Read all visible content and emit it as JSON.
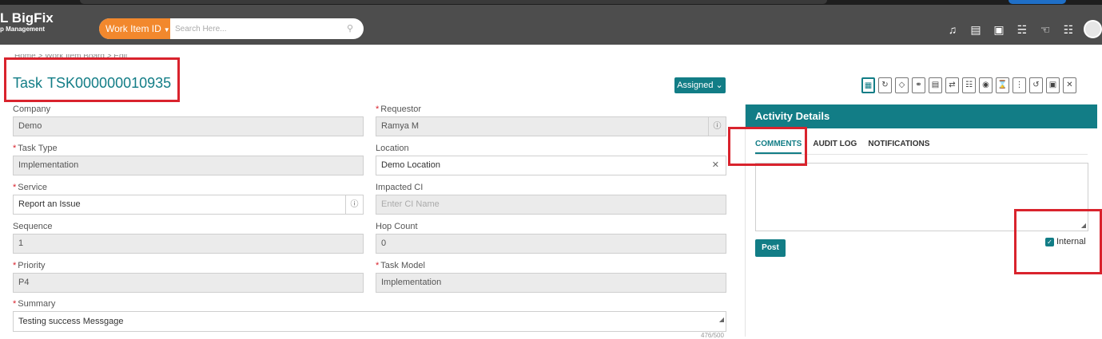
{
  "header": {
    "brand_line1": "L BigFix",
    "brand_line2": "p Management",
    "work_item_label": "Work Item ID",
    "search_placeholder": "Search Here...",
    "icons": [
      "bell-icon",
      "document-icon",
      "message-plus-icon",
      "gift-icon",
      "thumbs-up-icon",
      "cart-icon"
    ]
  },
  "breadcrumb": "Home  >  Work Item Board  >  Edit",
  "task": {
    "type_label": "Task",
    "id": "TSK000000010935",
    "status": "Assigned"
  },
  "fields": {
    "company": {
      "label": "Company",
      "value": "Demo"
    },
    "requestor": {
      "label": "Requestor",
      "value": "Ramya M"
    },
    "task_type": {
      "label": "Task Type",
      "value": "Implementation"
    },
    "location": {
      "label": "Location",
      "value": "Demo Location"
    },
    "service": {
      "label": "Service",
      "value": "Report an Issue"
    },
    "impacted_ci": {
      "label": "Impacted CI",
      "placeholder": "Enter CI Name"
    },
    "sequence": {
      "label": "Sequence",
      "value": "1"
    },
    "hop_count": {
      "label": "Hop Count",
      "value": "0"
    },
    "priority": {
      "label": "Priority",
      "value": "P4"
    },
    "task_model": {
      "label": "Task Model",
      "value": "Implementation"
    },
    "summary": {
      "label": "Summary",
      "value": "Testing success Messgage",
      "counter": "476/500"
    }
  },
  "activity": {
    "title": "Activity Details",
    "tabs": [
      "COMMENTS",
      "AUDIT LOG",
      "NOTIFICATIONS"
    ],
    "post_label": "Post",
    "internal_label": "Internal"
  },
  "colors": {
    "teal": "#127d86",
    "orange": "#f2882d",
    "header": "#4d4d4d",
    "highlight": "#d9232d"
  }
}
